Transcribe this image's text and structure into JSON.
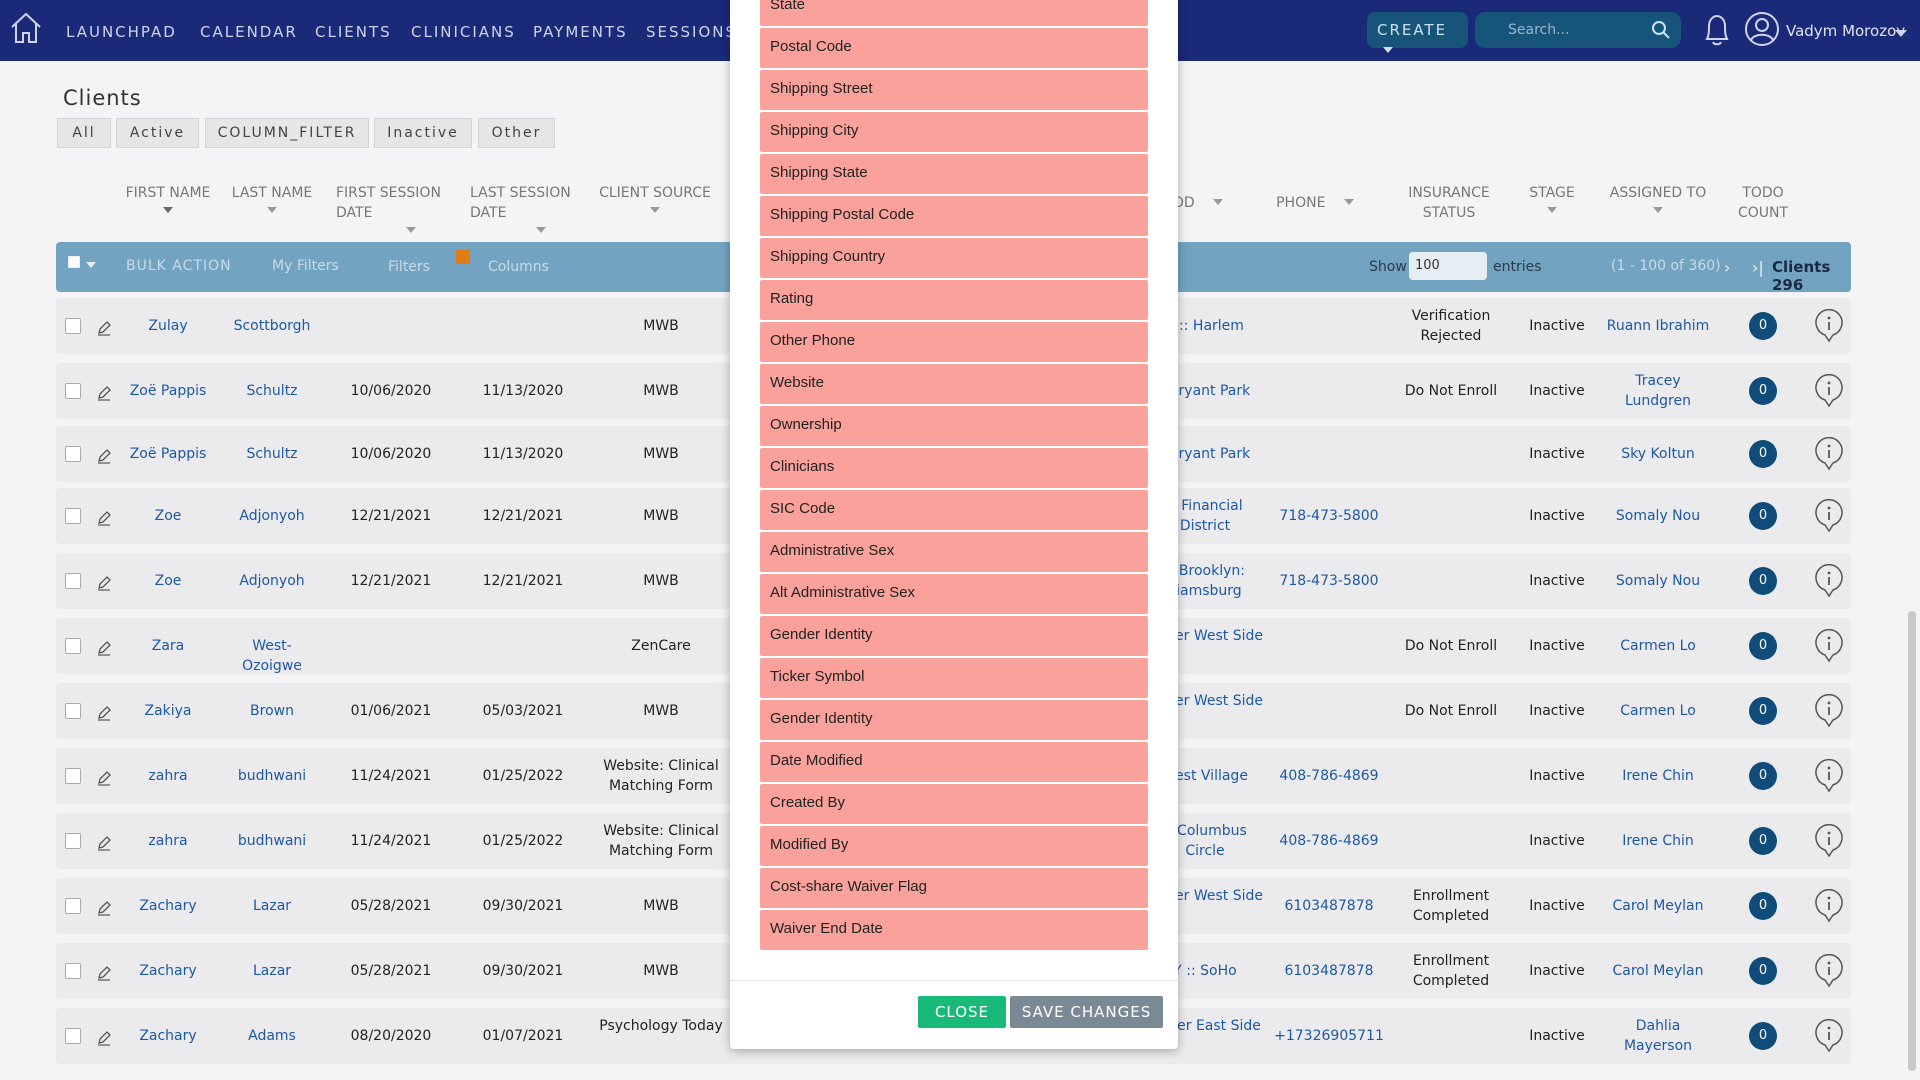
{
  "nav": {
    "items": [
      "LAUNCHPAD",
      "CALENDAR",
      "CLIENTS",
      "CLINICIANS",
      "PAYMENTS",
      "SESSIONS"
    ],
    "create_label": "CREATE",
    "search_placeholder": "Search...",
    "user_name": "Vadym Morozov"
  },
  "page": {
    "title": "Clients",
    "filter_tabs": [
      "All",
      "Active",
      "COLUMN_FILTER",
      "Inactive",
      "Other"
    ]
  },
  "table": {
    "headers": [
      "FIRST NAME",
      "LAST NAME",
      "FIRST SESSION DATE",
      "LAST SESSION DATE",
      "CLIENT SOURCE",
      "OD",
      "PHONE",
      "INSURANCE STATUS",
      "STAGE",
      "ASSIGNED TO",
      "TODO COUNT"
    ],
    "toolbar": {
      "bulk_action": "BULK ACTION",
      "my_filters": "My Filters",
      "filters": "Filters",
      "columns": "Columns",
      "show_label": "Show",
      "show_value": "100",
      "entries_label": "entries",
      "pagination": "(1 - 100 of 360)",
      "clients_count": "Clients 296"
    },
    "rows": [
      {
        "first": "Zulay",
        "last": "Scottborgh",
        "first_session": "",
        "last_session": "",
        "source": "MWB",
        "location": "Y :: Harlem",
        "phone": "",
        "insurance": "Verification Rejected",
        "stage": "Inactive",
        "assigned": "Ruann Ibrahim",
        "todo": "0"
      },
      {
        "first": "Zoë Pappis",
        "last": "Schultz",
        "first_session": "10/06/2020",
        "last_session": "11/13/2020",
        "source": "MWB",
        "location": ": Bryant Park",
        "phone": "",
        "insurance": "Do Not Enroll",
        "stage": "Inactive",
        "assigned": "Tracey Lundgren",
        "todo": "0"
      },
      {
        "first": "Zoë Pappis",
        "last": "Schultz",
        "first_session": "10/06/2020",
        "last_session": "11/13/2020",
        "source": "MWB",
        "location": ": Bryant Park",
        "phone": "",
        "insurance": "",
        "stage": "Inactive",
        "assigned": "Sky Koltun",
        "todo": "0"
      },
      {
        "first": "Zoe",
        "last": "Adjonyoh",
        "first_session": "12/21/2021",
        "last_session": "12/21/2021",
        "source": "MWB",
        "location": ":: Financial District",
        "phone": "718-473-5800",
        "insurance": "",
        "stage": "Inactive",
        "assigned": "Somaly Nou",
        "todo": "0"
      },
      {
        "first": "Zoe",
        "last": "Adjonyoh",
        "first_session": "12/21/2021",
        "last_session": "12/21/2021",
        "source": "MWB",
        "location": ":: Brooklyn: lliamsburg",
        "phone": "718-473-5800",
        "insurance": "",
        "stage": "Inactive",
        "assigned": "Somaly Nou",
        "todo": "0"
      },
      {
        "first": "Zara",
        "last": "West-Ozoigwe",
        "first_session": "",
        "last_session": "",
        "source": "ZenCare",
        "location": "Upper West Side",
        "phone": "",
        "insurance": "Do Not Enroll",
        "stage": "Inactive",
        "assigned": "Carmen Lo",
        "todo": "0"
      },
      {
        "first": "Zakiya",
        "last": "Brown",
        "first_session": "01/06/2021",
        "last_session": "05/03/2021",
        "source": "MWB",
        "location": "Upper West Side",
        "phone": "",
        "insurance": "Do Not Enroll",
        "stage": "Inactive",
        "assigned": "Carmen Lo",
        "todo": "0"
      },
      {
        "first": "zahra",
        "last": "budhwani",
        "first_session": "11/24/2021",
        "last_session": "01/25/2022",
        "source": "Website: Clinical Matching Form",
        "location": "West Village",
        "phone": "408-786-4869",
        "insurance": "",
        "stage": "Inactive",
        "assigned": "Irene Chin",
        "todo": "0"
      },
      {
        "first": "zahra",
        "last": "budhwani",
        "first_session": "11/24/2021",
        "last_session": "01/25/2022",
        "source": "Website: Clinical Matching Form",
        "location": ":: Columbus Circle",
        "phone": "408-786-4869",
        "insurance": "",
        "stage": "Inactive",
        "assigned": "Irene Chin",
        "todo": "0"
      },
      {
        "first": "Zachary",
        "last": "Lazar",
        "first_session": "05/28/2021",
        "last_session": "09/30/2021",
        "source": "MWB",
        "location": "Upper West Side",
        "phone": "6103487878",
        "insurance": "Enrollment Completed",
        "stage": "Inactive",
        "assigned": "Carol Meylan",
        "todo": "0"
      },
      {
        "first": "Zachary",
        "last": "Lazar",
        "first_session": "05/28/2021",
        "last_session": "09/30/2021",
        "source": "MWB",
        "location": "Y :: SoHo",
        "phone": "6103487878",
        "insurance": "Enrollment Completed",
        "stage": "Inactive",
        "assigned": "Carol Meylan",
        "todo": "0"
      },
      {
        "first": "Zachary",
        "last": "Adams",
        "first_session": "08/20/2020",
        "last_session": "01/07/2021",
        "source": "Psychology Today",
        "location": "Upper East Side",
        "phone": "+17326905711",
        "insurance": "",
        "stage": "Inactive",
        "assigned": "Dahlia Mayerson",
        "todo": "0"
      }
    ]
  },
  "modal": {
    "columns": [
      "State",
      "Postal Code",
      "Shipping Street",
      "Shipping City",
      "Shipping State",
      "Shipping Postal Code",
      "Shipping Country",
      "Rating",
      "Other Phone",
      "Website",
      "Ownership",
      "Clinicians",
      "SIC Code",
      "Administrative Sex",
      "Alt Administrative Sex",
      "Gender Identity",
      "Ticker Symbol",
      "Gender Identity",
      "Date Modified",
      "Created By",
      "Modified By",
      "Cost-share Waiver Flag",
      "Waiver End Date"
    ],
    "close_label": "CLOSE",
    "save_label": "SAVE CHANGES"
  },
  "colors": {
    "nav_bg": "#1b2a78",
    "toolbar_bg": "#72a4c2",
    "column_item_bg": "#f9a19a",
    "close_btn": "#18b979",
    "save_btn": "#7a8a94",
    "todo_badge": "#0f4c7a"
  }
}
